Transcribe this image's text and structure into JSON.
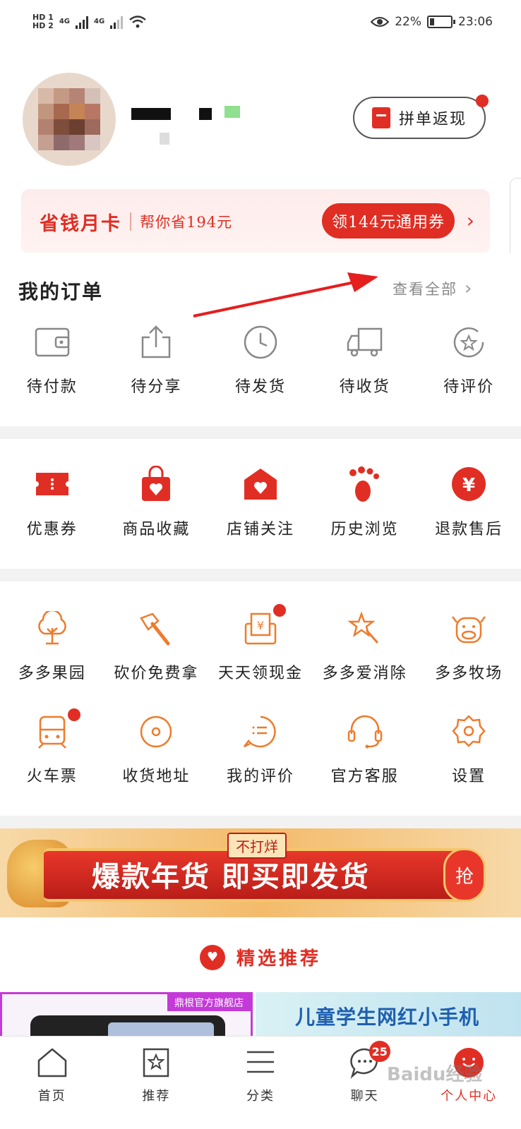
{
  "status_bar": {
    "hd1": "HD 1",
    "hd2": "HD 2",
    "net1": "4G",
    "net2": "4G",
    "battery": "22%",
    "time": "23:06",
    "battery_level": 0.22
  },
  "profile": {
    "return_button": "拼单返现"
  },
  "savings_card": {
    "title": "省钱月卡",
    "subtitle": "帮你省194元",
    "coupon_button": "领144元通用券"
  },
  "orders": {
    "title": "我的订单",
    "view_all": "查看全部",
    "items": [
      {
        "label": "待付款",
        "icon": "wallet-icon"
      },
      {
        "label": "待分享",
        "icon": "share-icon"
      },
      {
        "label": "待发货",
        "icon": "clock-icon"
      },
      {
        "label": "待收货",
        "icon": "truck-icon"
      },
      {
        "label": "待评价",
        "icon": "review-star-icon"
      }
    ]
  },
  "services": [
    {
      "label": "优惠券",
      "icon": "coupon-icon"
    },
    {
      "label": "商品收藏",
      "icon": "favorite-bag-icon"
    },
    {
      "label": "店铺关注",
      "icon": "store-icon"
    },
    {
      "label": "历史浏览",
      "icon": "footprint-icon"
    },
    {
      "label": "退款售后",
      "icon": "refund-icon"
    }
  ],
  "features": [
    {
      "label": "多多果园",
      "icon": "tree-icon"
    },
    {
      "label": "砍价免费拿",
      "icon": "axe-icon"
    },
    {
      "label": "天天领现金",
      "icon": "cash-icon"
    },
    {
      "label": "多多爱消除",
      "icon": "star-wand-icon"
    },
    {
      "label": "多多牧场",
      "icon": "cow-icon"
    },
    {
      "label": "火车票",
      "icon": "train-icon"
    },
    {
      "label": "收货地址",
      "icon": "location-icon"
    },
    {
      "label": "我的评价",
      "icon": "comment-icon"
    },
    {
      "label": "官方客服",
      "icon": "headset-icon"
    },
    {
      "label": "设置",
      "icon": "gear-icon"
    }
  ],
  "promo": {
    "tag": "不打烊",
    "text": "爆款年货 即买即发货",
    "button": "抢"
  },
  "recommend": {
    "title": "精选推荐"
  },
  "products": [
    {
      "store": "鼎根官方旗舰店"
    },
    {
      "text": "儿童学生网红小手机"
    }
  ],
  "tabbar": [
    {
      "label": "首页",
      "icon": "home-icon"
    },
    {
      "label": "推荐",
      "icon": "recommend-icon"
    },
    {
      "label": "分类",
      "icon": "category-icon"
    },
    {
      "label": "聊天",
      "icon": "chat-icon",
      "badge": "25"
    },
    {
      "label": "个人中心",
      "icon": "profile-icon",
      "active": true
    }
  ],
  "watermark": "Baidu经验",
  "colors": {
    "accent": "#e02e24",
    "feature_orange": "#ef7b2b"
  }
}
